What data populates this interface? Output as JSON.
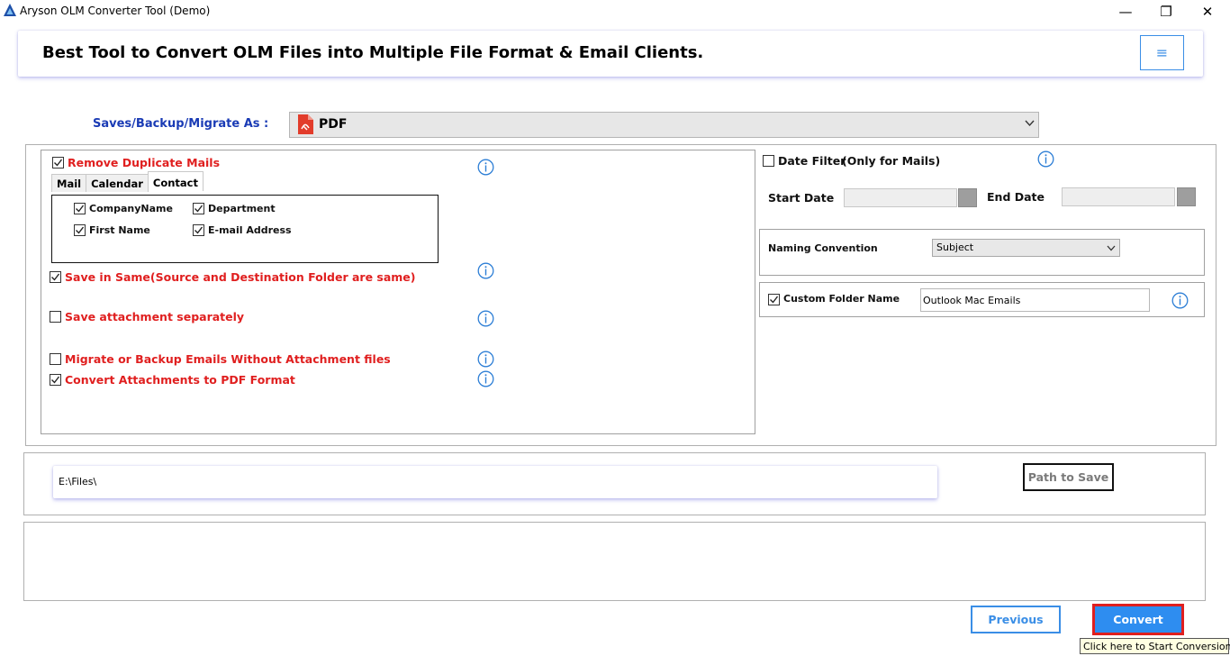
{
  "window": {
    "title": "Aryson OLM Converter Tool (Demo)",
    "minimize": "—",
    "maximize": "❐",
    "close": "✕"
  },
  "header": {
    "title": "Best Tool to Convert OLM Files into Multiple File Format & Email Clients.",
    "menu_icon": "≡"
  },
  "save_as": {
    "label": "Saves/Backup/Migrate As :",
    "selected": "PDF"
  },
  "options": {
    "remove_duplicates": {
      "label": "Remove Duplicate Mails",
      "checked": true
    },
    "tabs": [
      "Mail",
      "Calendar",
      "Contact"
    ],
    "active_tab": "Contact",
    "contact_fields": [
      {
        "label": "CompanyName",
        "checked": true
      },
      {
        "label": "Department",
        "checked": true
      },
      {
        "label": "First Name",
        "checked": true
      },
      {
        "label": "E-mail Address",
        "checked": true
      }
    ],
    "save_in_same": {
      "label": "Save in Same(Source and Destination Folder are same)",
      "checked": true
    },
    "save_attachment": {
      "label": "Save attachment separately",
      "checked": false
    },
    "without_attachment": {
      "label": "Migrate or Backup Emails Without Attachment files",
      "checked": false
    },
    "convert_attachments": {
      "label": "Convert Attachments to PDF Format",
      "checked": true
    }
  },
  "date_filter": {
    "label": "Date Filter",
    "note": "(Only for Mails)",
    "checked": false,
    "start_label": "Start Date",
    "end_label": "End Date"
  },
  "naming": {
    "label": "Naming Convention",
    "selected": "Subject"
  },
  "custom_folder": {
    "label": "Custom Folder Name",
    "checked": true,
    "value": "Outlook Mac Emails"
  },
  "path": {
    "value": "E:\\Files\\",
    "button": "Path to Save"
  },
  "footer": {
    "previous": "Previous",
    "convert": "Convert",
    "tooltip": "Click here to Start Conversion."
  },
  "colors": {
    "accent_blue": "#2e8df0",
    "label_red": "#e01f1f",
    "label_navy": "#1a3bb5"
  }
}
